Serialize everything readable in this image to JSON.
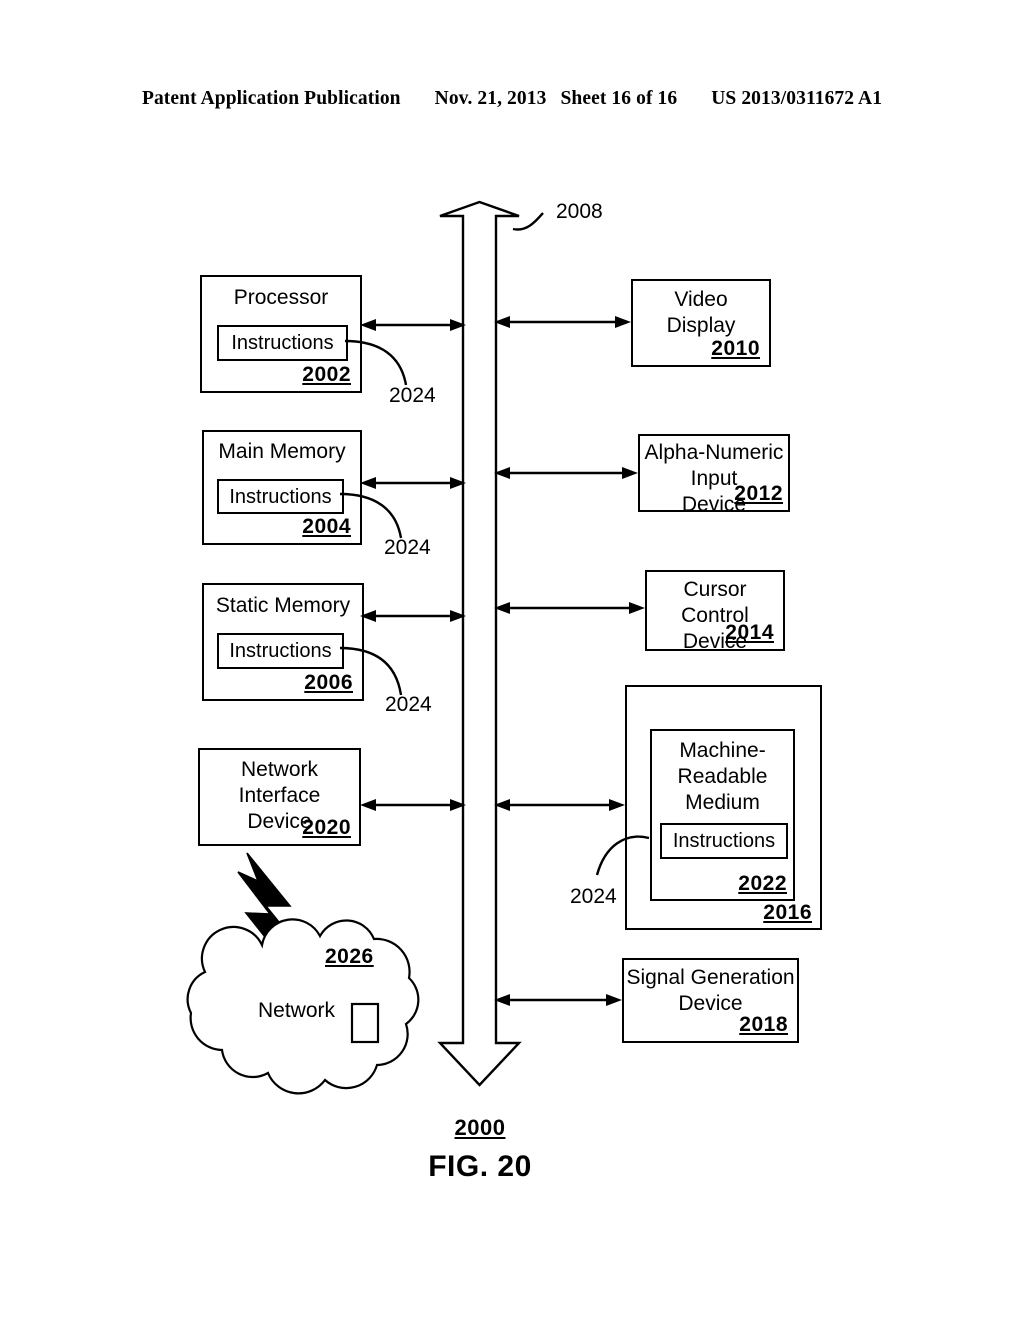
{
  "header": {
    "publication": "Patent Application Publication",
    "date": "Nov. 21, 2013",
    "sheet": "Sheet 16 of 16",
    "patent_number": "US 2013/0311672 A1"
  },
  "figure": {
    "caption": "FIG. 20",
    "system_ref": "2000",
    "bus_ref": "2008"
  },
  "left_column": [
    {
      "name": "processor",
      "title": "Processor",
      "ref": "2002",
      "inner_label": "Instructions",
      "leader_ref": "2024"
    },
    {
      "name": "main-memory",
      "title": "Main Memory",
      "ref": "2004",
      "inner_label": "Instructions",
      "leader_ref": "2024"
    },
    {
      "name": "static-memory",
      "title": "Static Memory",
      "ref": "2006",
      "inner_label": "Instructions",
      "leader_ref": "2024"
    },
    {
      "name": "network-interface-device",
      "title": "Network\nInterface\nDevice",
      "ref": "2020"
    }
  ],
  "right_column": [
    {
      "name": "video-display",
      "title": "Video\nDisplay",
      "ref": "2010"
    },
    {
      "name": "alpha-numeric-input-device",
      "title": "Alpha-Numeric\nInput\nDevice",
      "ref": "2012"
    },
    {
      "name": "cursor-control-device",
      "title": "Cursor Control\nDevice",
      "ref": "2014"
    },
    {
      "name": "drive-unit",
      "title": "",
      "ref": "2016",
      "inner": {
        "name": "machine-readable-medium",
        "title": "Machine-\nReadable\nMedium",
        "ref": "2022",
        "inner_label": "Instructions",
        "leader_ref": "2024"
      }
    },
    {
      "name": "signal-generation-device",
      "title": "Signal Generation\nDevice",
      "ref": "2018"
    }
  ],
  "network": {
    "label": "Network",
    "ref": "2026"
  },
  "colors": {
    "stroke": "#000000",
    "background": "#ffffff"
  }
}
